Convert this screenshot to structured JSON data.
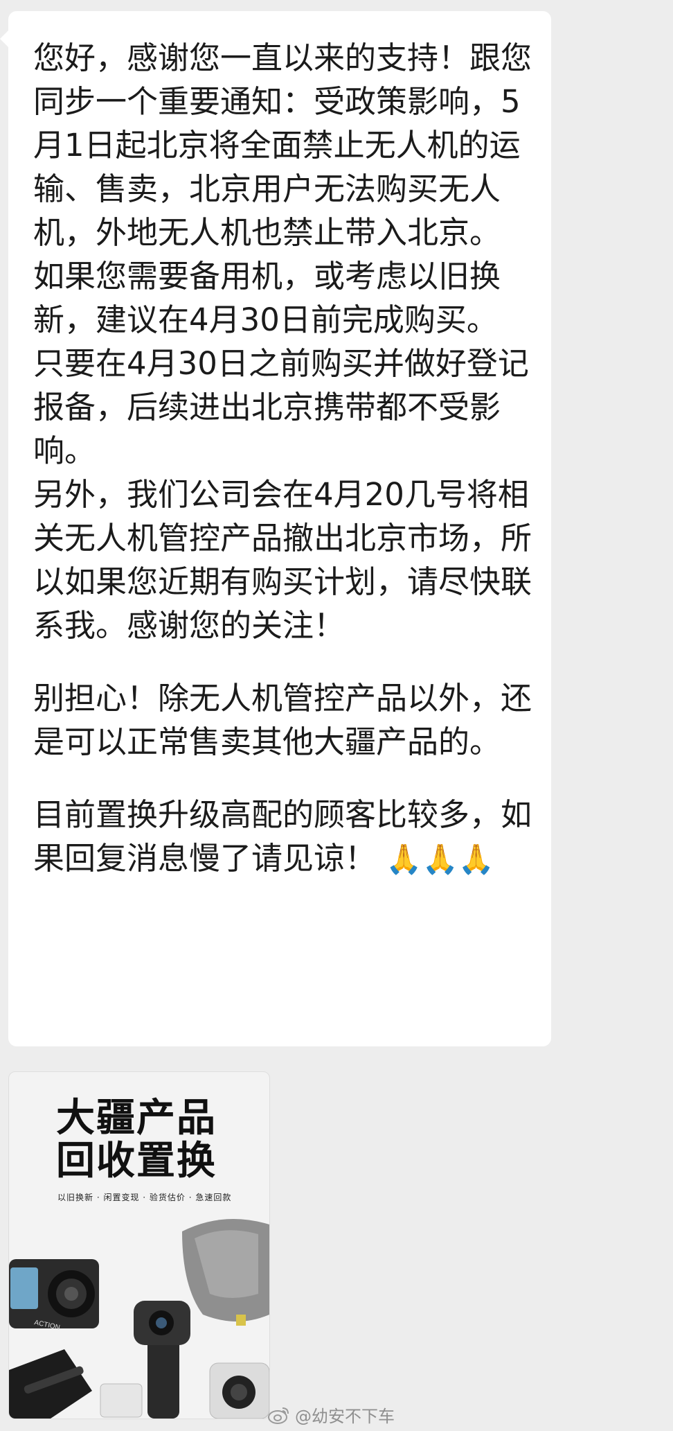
{
  "message": {
    "paragraphs": [
      "您好，感谢您一直以来的支持！跟您同步一个重要通知：受政策影响，5月1日起北京将全面禁止无人机的运输、售卖，北京用户无法购买无人机，外地无人机也禁止带入北京。",
      "如果您需要备用机，或考虑以旧换新，建议在4月30日前完成购买。",
      "只要在4月30日之前购买并做好登记报备，后续进出北京携带都不受影响。",
      "另外，我们公司会在4月20几号将相关无人机管控产品撤出北京市场，所以如果您近期有购买计划，请尽快联系我。感谢您的关注！",
      "别担心！除无人机管控产品以外，还是可以正常售卖其他大疆产品的。",
      "目前置换升级高配的顾客比较多，如果回复消息慢了请见谅！"
    ],
    "emojis": [
      "🙏",
      "🙏",
      "🙏"
    ]
  },
  "card": {
    "title_line1": "大疆产品",
    "title_line2": "回收置换",
    "subtitle": "以旧换新 · 闲置变现 · 验货估价 · 急速回款",
    "product_label": "ACTION"
  },
  "watermark": {
    "text": "@幼安不下车",
    "icon": "weibo-icon"
  },
  "colors": {
    "background": "#ededed",
    "bubble": "#ffffff",
    "text": "#1b1b1b"
  }
}
